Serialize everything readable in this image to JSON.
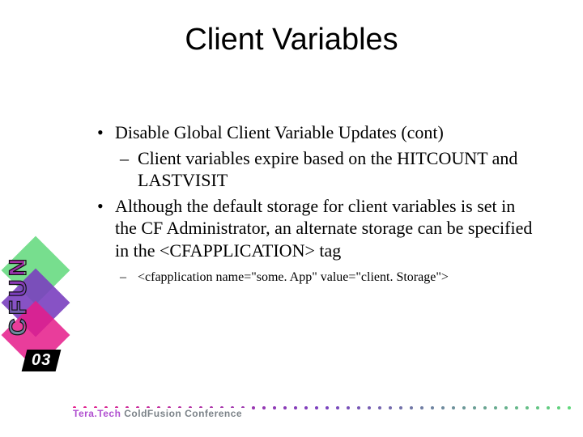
{
  "title": "Client Variables",
  "bullets": {
    "b1": "Disable Global Client Variable Updates (cont)",
    "b1a": "Client variables expire based on the HITCOUNT and LASTVISIT",
    "b2": "Although the default storage for client variables is set in the CF Administrator, an alternate storage can be specified in the <CFAPPLICATION> tag",
    "b2a": "<cfapplication name=\"some. App\" value=\"client. Storage\">"
  },
  "logo": {
    "cfun": "CFUN",
    "year": "03"
  },
  "footer": {
    "brand_head": "Tera.Tech",
    "brand_tail": " ColdFusion Conference"
  },
  "colors": {
    "dot_start": "#e51b8a",
    "dot_mid": "#7a3fbf",
    "dot_end": "#5fd87a"
  }
}
